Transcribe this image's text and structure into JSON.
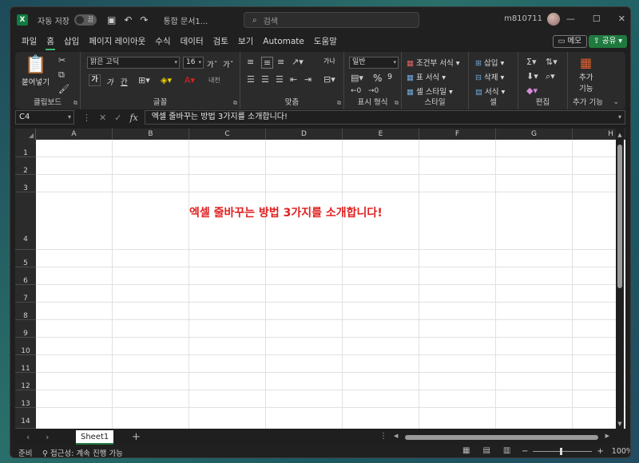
{
  "title_bar": {
    "autosave_label": "자동 저장",
    "autosave_state": "끔",
    "doc_name": "통합 문서1...",
    "search_placeholder": "검색",
    "user": "m810711"
  },
  "menu": {
    "tabs": [
      "파일",
      "홈",
      "삽입",
      "페이지 레이아웃",
      "수식",
      "데이터",
      "검토",
      "보기",
      "Automate",
      "도움말"
    ],
    "active": "홈",
    "memo_label": "메모",
    "share_label": "공유"
  },
  "ribbon": {
    "clipboard": {
      "label": "클립보드",
      "paste": "붙여넣기"
    },
    "font": {
      "label": "글꼴",
      "font_name": "맑은 고딕",
      "font_size": "16",
      "grow": "가ˆ",
      "shrink": "가ˇ",
      "bold": "가",
      "italic": "가",
      "underline": "간",
      "phonetic": "내천"
    },
    "alignment": {
      "label": "맞춤",
      "wrap": "가나"
    },
    "number": {
      "label": "표시 형식",
      "format": "일반",
      "percent": "%",
      "comma": "9"
    },
    "styles": {
      "label": "스타일",
      "conditional": "조건부 서식",
      "table": "표 서식",
      "cell": "셀 스타일"
    },
    "cells": {
      "label": "셀",
      "insert": "삽입",
      "delete": "삭제",
      "format": "서식"
    },
    "editing": {
      "label": "편집"
    },
    "addins": {
      "label": "추가 기능",
      "button": "추가\n기능",
      "line1": "추가",
      "line2": "기능"
    }
  },
  "formula_bar": {
    "name_box": "C4",
    "content": "엑셀 줄바꾸는 방법 3가지를 소개합니다!",
    "fx": "fx"
  },
  "grid": {
    "columns": [
      "A",
      "B",
      "C",
      "D",
      "E",
      "F",
      "G",
      "H"
    ],
    "rows": [
      "1",
      "2",
      "3",
      "4",
      "5",
      "6",
      "7",
      "8",
      "9",
      "10",
      "11",
      "12",
      "13",
      "14"
    ],
    "cell_text": "엑셀 줄바꾸는 방법 3가지를 소개합니다!",
    "cell_color": "#e02020"
  },
  "sheets": {
    "tabs": [
      "Sheet1"
    ],
    "active": "Sheet1",
    "add": "+"
  },
  "status_bar": {
    "ready": "준비",
    "accessibility": "접근성: 계속 진행 가능",
    "zoom": "100%"
  },
  "colors": {
    "accent": "#1f7a3f",
    "active_tab_underline": "#3fb66c"
  }
}
